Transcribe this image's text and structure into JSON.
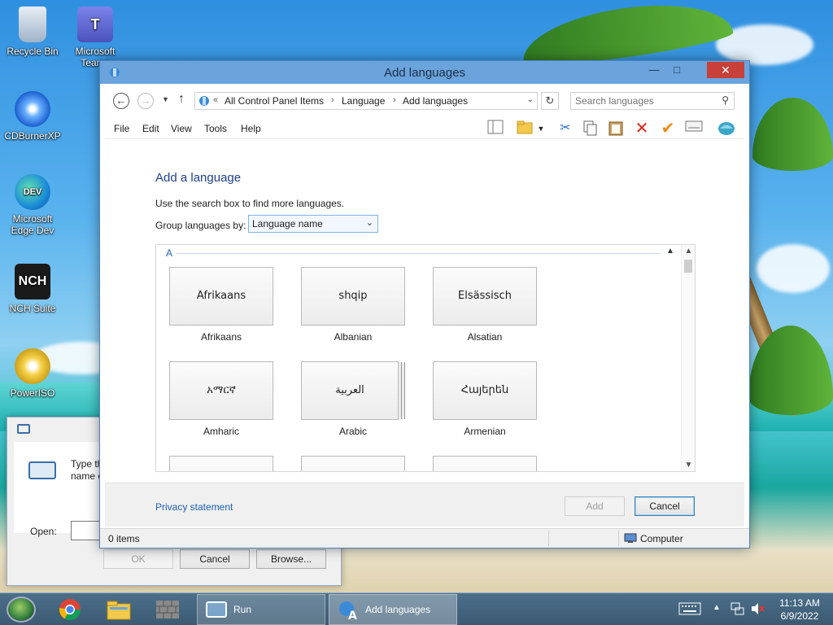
{
  "desktop": {
    "icons": [
      {
        "label": "Recycle Bin"
      },
      {
        "label": "Microsoft Teams"
      },
      {
        "label": "CDBurnerXP"
      },
      {
        "label": "Microsoft Edge Dev"
      },
      {
        "label": "NCH Suite"
      },
      {
        "label": "PowerISO"
      }
    ]
  },
  "run_dialog": {
    "text": "Type the name of a program, folder, document, or Internet resource",
    "open_label": "Open:",
    "ok_label": "OK",
    "cancel_label": "Cancel",
    "browse_label": "Browse..."
  },
  "window": {
    "title": "Add languages",
    "minimize": "—",
    "maximize": "□",
    "close": "✕",
    "breadcrumb_prefix": "«",
    "breadcrumbs": [
      "All Control Panel Items",
      "Language",
      "Add languages"
    ],
    "search_placeholder": "Search languages",
    "menu": [
      "File",
      "Edit",
      "View",
      "Tools",
      "Help"
    ],
    "toolbar_icons": [
      "layout-icon",
      "folder-icon",
      "cut-icon",
      "copy-icon",
      "paste-icon",
      "delete-icon",
      "check-icon",
      "properties-icon",
      "shell-icon"
    ]
  },
  "content": {
    "heading": "Add a language",
    "hint": "Use the search box to find more languages.",
    "group_by_label": "Group languages by:",
    "group_by_value": "Language name",
    "group_header": "A",
    "languages": [
      {
        "native": "Afrikaans",
        "name": "Afrikaans"
      },
      {
        "native": "shqip",
        "name": "Albanian"
      },
      {
        "native": "Elsässisch",
        "name": "Alsatian"
      },
      {
        "native": "አማርኛ",
        "name": "Amharic"
      },
      {
        "native": "العربية",
        "name": "Arabic"
      },
      {
        "native": "Հայերեն",
        "name": "Armenian"
      }
    ]
  },
  "footer": {
    "privacy_link": "Privacy statement",
    "add_label": "Add",
    "cancel_label": "Cancel"
  },
  "statusbar": {
    "items": "0 items",
    "location": "Computer"
  },
  "taskbar": {
    "tasks": [
      {
        "label": "Run"
      },
      {
        "label": "Add languages"
      }
    ],
    "time": "11:13 AM",
    "date": "6/9/2022"
  }
}
